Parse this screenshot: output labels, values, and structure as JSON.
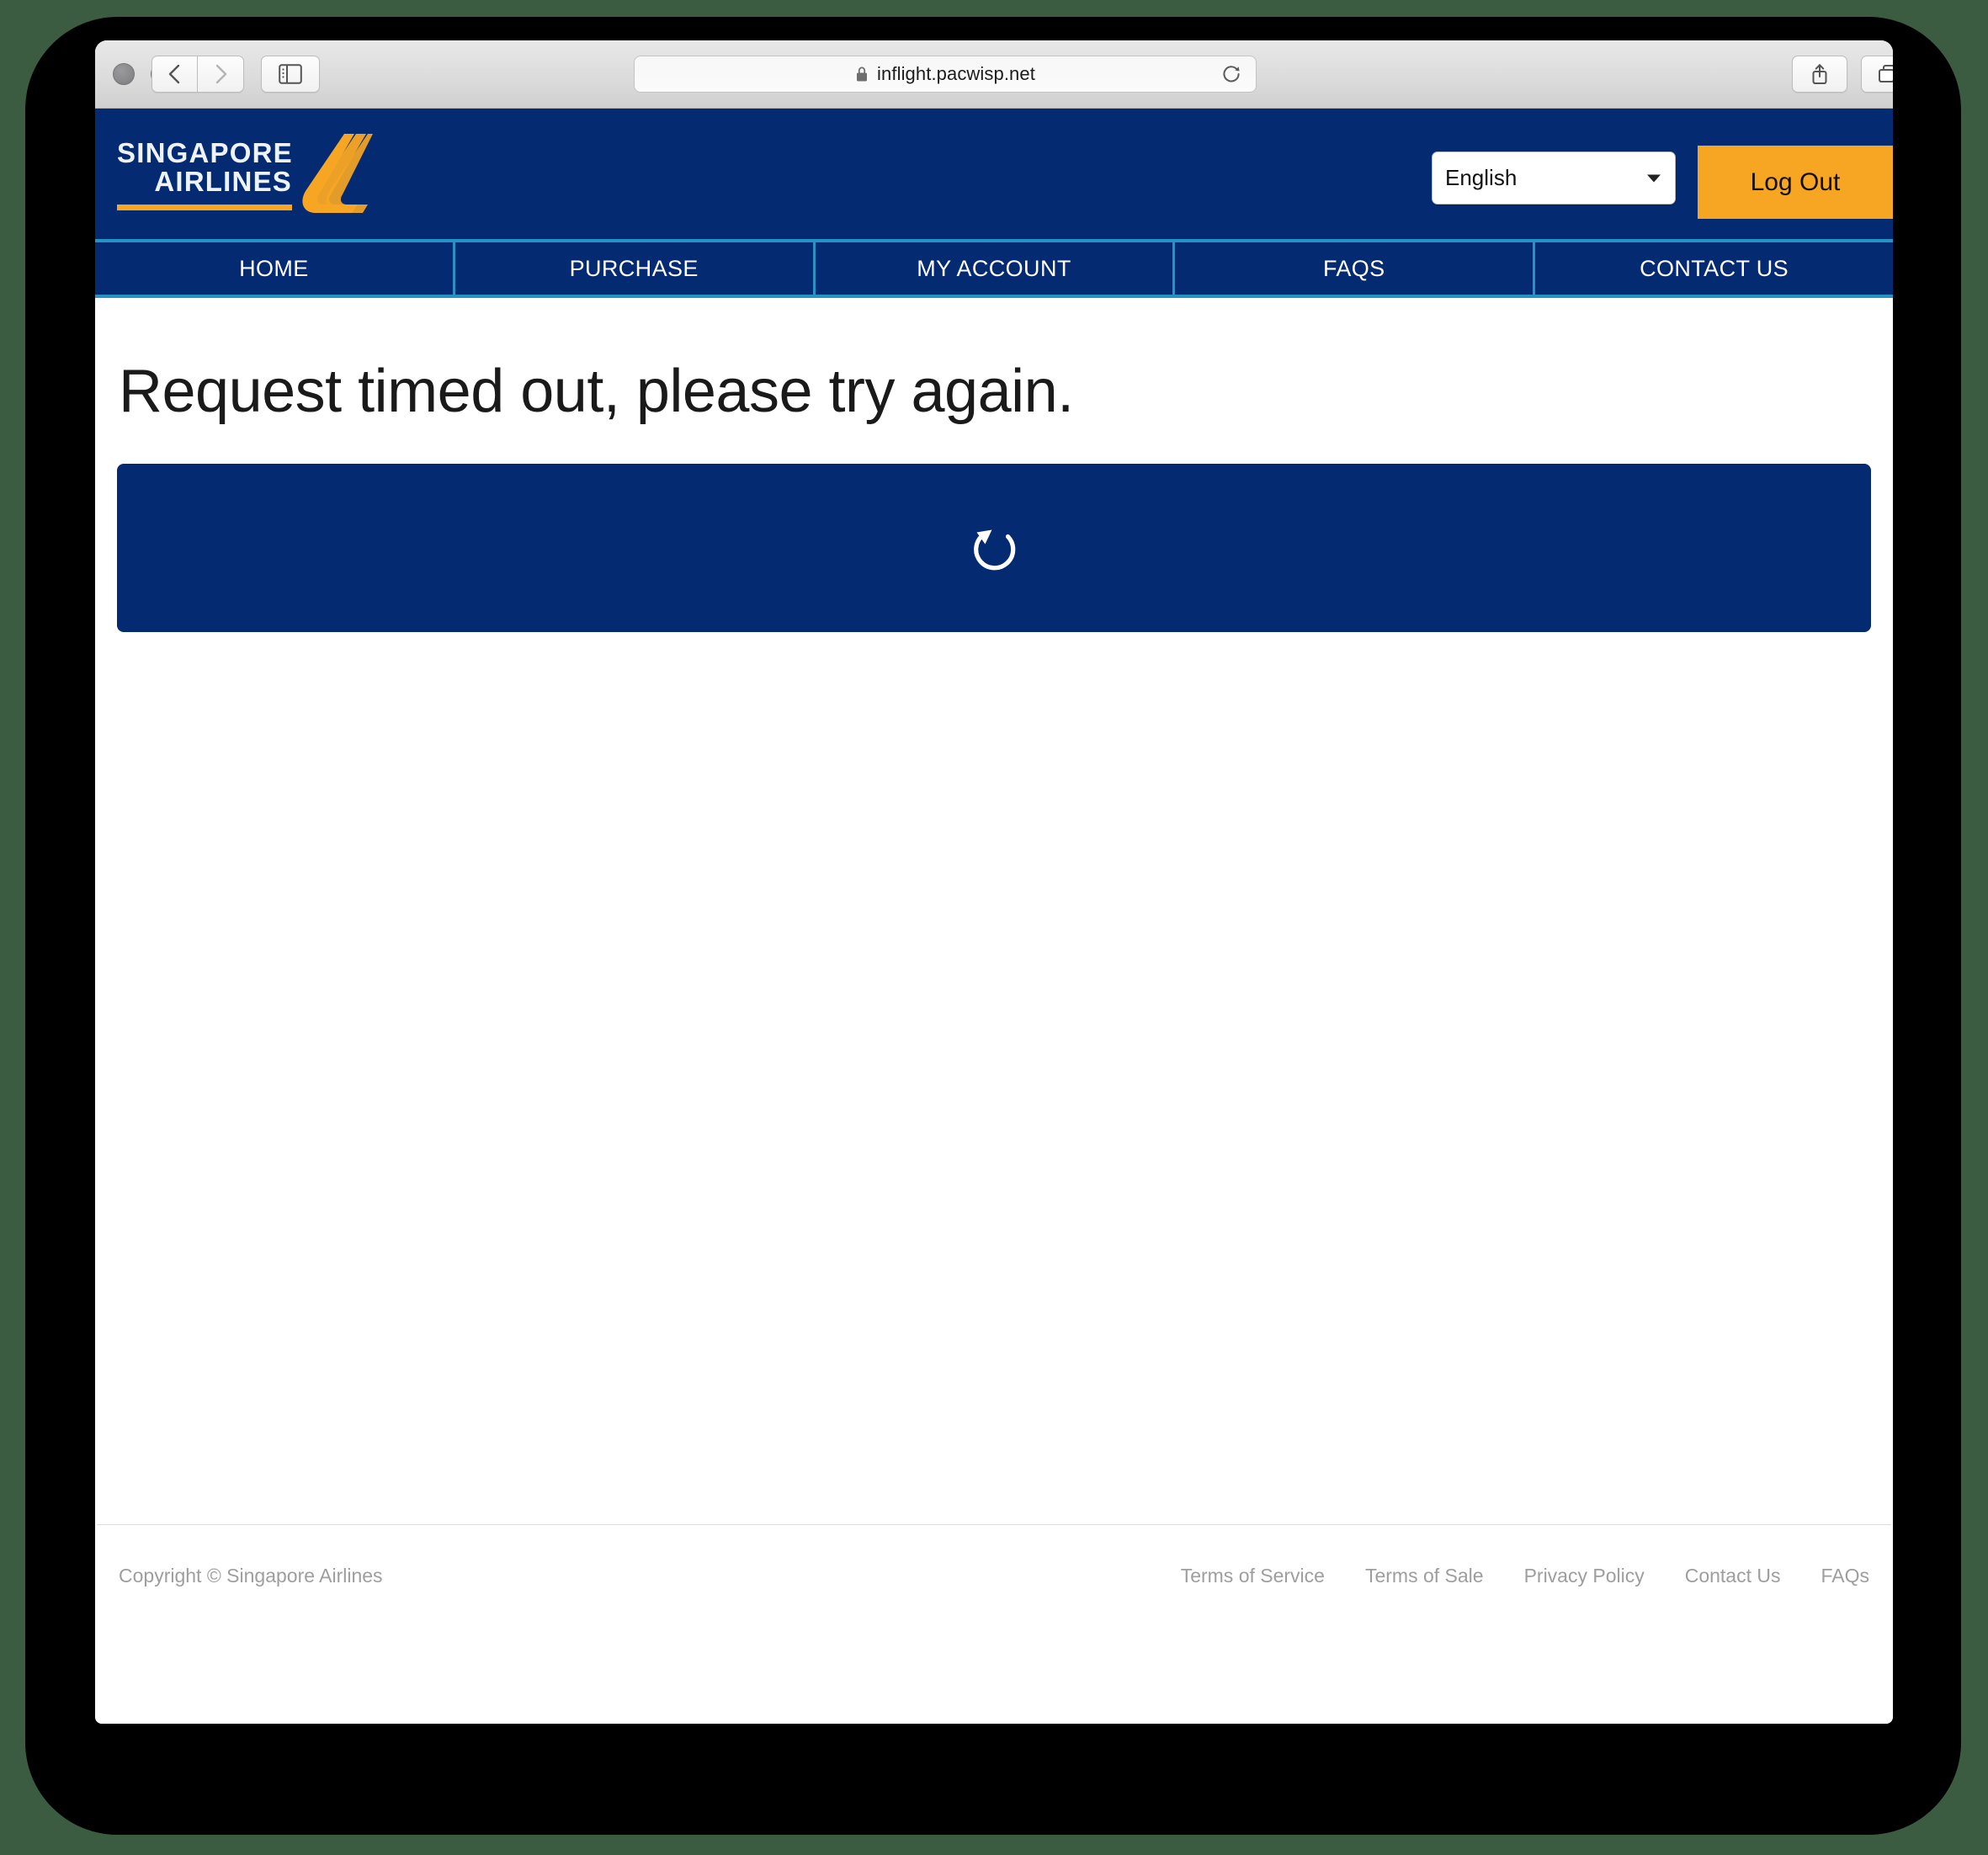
{
  "browser": {
    "url": "inflight.pacwisp.net",
    "lock_icon": "lock-icon",
    "reload_icon": "reload-icon",
    "back_icon": "chevron-left-icon",
    "forward_icon": "chevron-right-icon",
    "sidebar_icon": "sidebar-icon",
    "share_icon": "share-icon",
    "tabs_icon": "tab-overview-icon",
    "new_tab_label": "+"
  },
  "header": {
    "logo": {
      "line1": "SINGAPORE",
      "line2": "AIRLINES",
      "bird_icon": "singapore-airlines-bird-icon"
    },
    "language": {
      "selected": "English",
      "options": [
        "English"
      ]
    },
    "logout_label": "Log Out",
    "brand_navy": "#042a72",
    "brand_gold": "#f6a623",
    "accent_cyan": "#2792c4"
  },
  "nav": {
    "items": [
      {
        "label": "HOME",
        "name": "nav-item-home"
      },
      {
        "label": "PURCHASE",
        "name": "nav-item-purchase"
      },
      {
        "label": "MY ACCOUNT",
        "name": "nav-item-my-account"
      },
      {
        "label": "FAQS",
        "name": "nav-item-faqs"
      },
      {
        "label": "CONTACT US",
        "name": "nav-item-contact-us"
      }
    ]
  },
  "main": {
    "error_message": "Request timed out, please try again.",
    "retry_icon": "refresh-circular-arrow-icon"
  },
  "footer": {
    "copyright": "Copyright © Singapore Airlines",
    "links": [
      {
        "label": "Terms of Service"
      },
      {
        "label": "Terms of Sale"
      },
      {
        "label": "Privacy Policy"
      },
      {
        "label": "Contact Us"
      },
      {
        "label": "FAQs"
      }
    ]
  }
}
